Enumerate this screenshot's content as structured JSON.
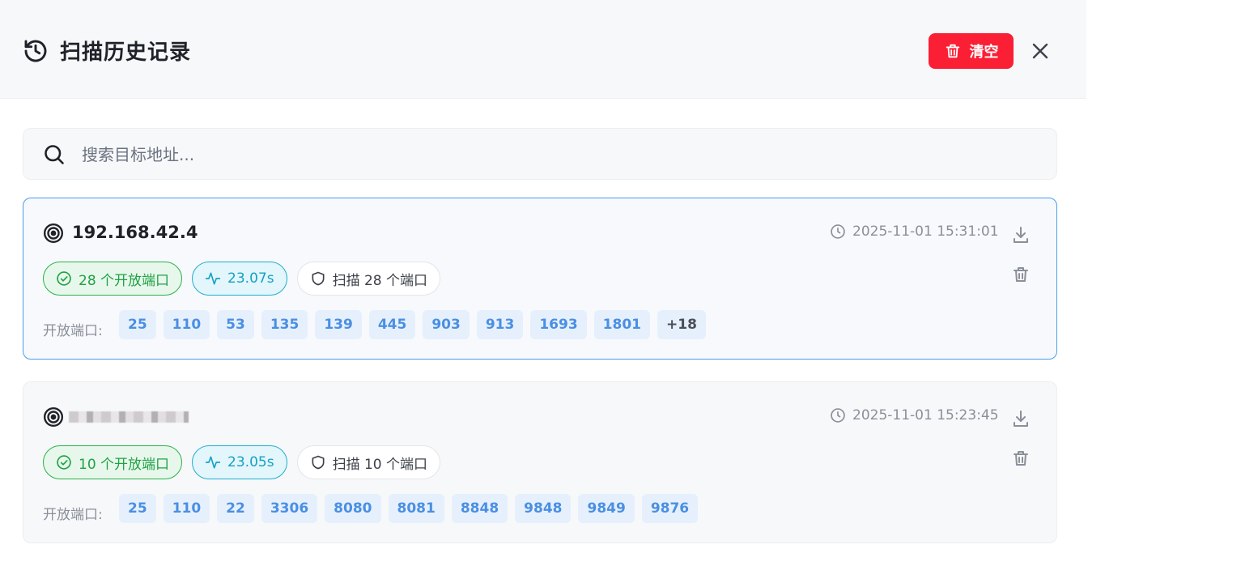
{
  "header": {
    "title": "扫描历史记录",
    "clear_label": "清空"
  },
  "search": {
    "placeholder": "搜索目标地址..."
  },
  "records": [
    {
      "target": "192.168.42.4",
      "target_redacted": false,
      "timestamp": "2025-11-01 15:31:01",
      "open_count_label": "28 个开放端口",
      "duration": "23.07s",
      "scanned_label": "扫描 28 个端口",
      "ports_label": "开放端口:",
      "ports": [
        "25",
        "110",
        "53",
        "135",
        "139",
        "445",
        "903",
        "913",
        "1693",
        "1801"
      ],
      "more": "+18"
    },
    {
      "target": "",
      "target_redacted": true,
      "timestamp": "2025-11-01 15:23:45",
      "open_count_label": "10 个开放端口",
      "duration": "23.05s",
      "scanned_label": "扫描 10 个端口",
      "ports_label": "开放端口:",
      "ports": [
        "25",
        "110",
        "22",
        "3306",
        "8080",
        "8081",
        "8848",
        "9848",
        "9849",
        "9876"
      ],
      "more": ""
    }
  ],
  "colors": {
    "danger": "#fb1f35",
    "success": "#1ea244",
    "info": "#15a1c4",
    "primary": "#4a8fe3",
    "active_border": "#4a9cf0"
  },
  "icons": {
    "title": "history-icon",
    "clear": "trash-icon",
    "close": "close-icon",
    "search": "search-icon",
    "target": "target-icon",
    "time": "clock-icon",
    "download": "download-icon",
    "delete": "trash-icon",
    "open": "check-circle-icon",
    "duration": "activity-icon",
    "scan": "shield-icon"
  }
}
